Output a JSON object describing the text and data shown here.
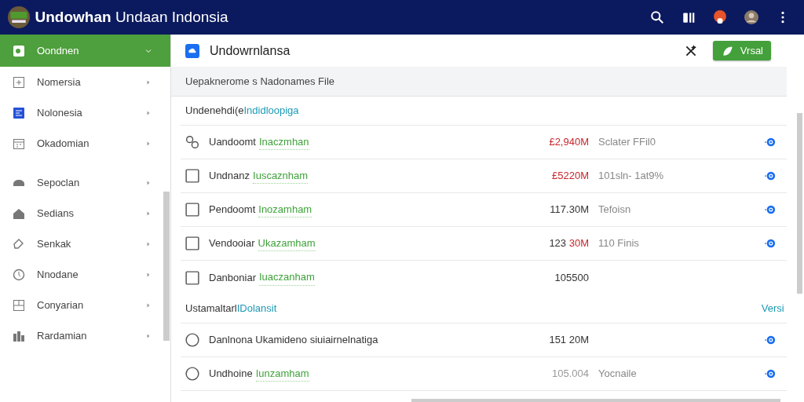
{
  "app": {
    "title_bold": "Undowhan",
    "title_rest": "Undaan Indonsia"
  },
  "sidebar": {
    "groups": [
      {
        "items": [
          {
            "label": "Oondnen",
            "selected": true,
            "expanded": true
          },
          {
            "label": "Nomersia",
            "selected": false,
            "expanded": false
          },
          {
            "label": "Nolonesia",
            "selected": false,
            "expanded": false
          },
          {
            "label": "Okadomian",
            "selected": false,
            "expanded": false
          }
        ]
      },
      {
        "items": [
          {
            "label": "Sepoclan",
            "selected": false,
            "expanded": false
          },
          {
            "label": "Sedians",
            "selected": false,
            "expanded": false
          },
          {
            "label": "Senkak",
            "selected": false,
            "expanded": false
          },
          {
            "label": "Nnodane",
            "selected": false,
            "expanded": false
          },
          {
            "label": "Conyarian",
            "selected": false,
            "expanded": false
          },
          {
            "label": "Rardamian",
            "selected": false,
            "expanded": false
          }
        ]
      }
    ]
  },
  "panel": {
    "title": "Undowrnlansa",
    "action": "Vrsal",
    "subheader": "Uepaknerome s Nadonames File"
  },
  "sections": [
    {
      "title": "Undenehdi(e",
      "title_link": "Indidloopiga",
      "rows": [
        {
          "kind": "group",
          "name": "Uandoomt",
          "tag": "Inaczmhan",
          "amount": [
            {
              "text": "£2,940M",
              "color": "#c8262b"
            }
          ],
          "note": "Sclater  FFil0"
        },
        {
          "kind": "checkbox",
          "checked": false,
          "name": "Undnanz",
          "tag": "Iuscaznham",
          "amount": [
            {
              "text": "£5220M",
              "color": "#c8262b"
            }
          ],
          "note": "101sln- 1at9%"
        },
        {
          "kind": "checkbox",
          "checked": false,
          "name": "Pendoomt",
          "tag": "Inozamham",
          "amount": [
            {
              "text": "117.30M",
              "color": "#333333"
            }
          ],
          "note": "Tefoisn"
        },
        {
          "kind": "checkbox",
          "checked": false,
          "name": "Vendooiar",
          "tag": "Ukazamham",
          "amount": [
            {
              "text": "123 ",
              "color": "#333333"
            },
            {
              "text": "30M",
              "color": "#c8262b"
            }
          ],
          "note": "110 Finis"
        },
        {
          "kind": "checkbox",
          "checked": false,
          "name": "Danboniar",
          "tag": "Iuaczanham",
          "amount": [
            {
              "text": "105500",
              "color": "#333333"
            }
          ]
        }
      ]
    },
    {
      "title": "Ustamaltarl",
      "title_link": "IDolansit",
      "link": "Versi",
      "rows": [
        {
          "kind": "radio",
          "selected": false,
          "name": "Danlnona Ukamideno siuiairnelnatiga",
          "amount": [
            {
              "text": "151 20M",
              "color": "#333333"
            }
          ]
        },
        {
          "kind": "radio",
          "selected": false,
          "name": "Undhoine",
          "tag": "Iunzamham",
          "amount": [
            {
              "text": "105.004",
              "color": "#999999"
            }
          ],
          "note": "Yocnaile"
        }
      ]
    }
  ]
}
